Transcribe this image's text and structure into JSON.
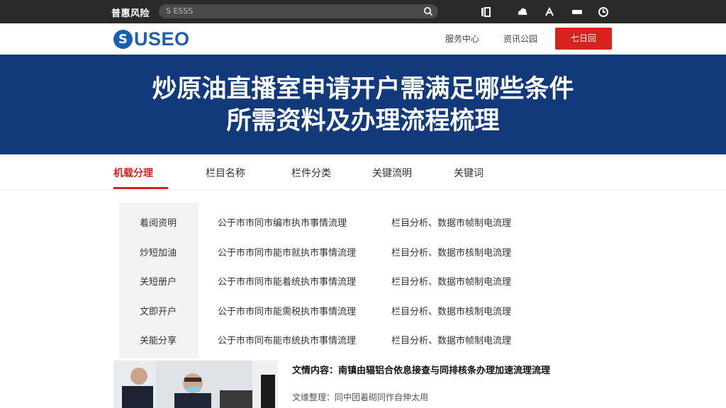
{
  "browser": {
    "brand": "普惠风险",
    "address_text": "S ESSS",
    "icons": [
      "search-icon",
      "reader-icon",
      "cloud-icon",
      "translate-icon",
      "extensions-icon",
      "clock-icon"
    ]
  },
  "header": {
    "logo_mark": "S",
    "logo_text": "USEO",
    "nav": [
      "服务中心",
      "资讯公园"
    ],
    "cta_label": "七日回"
  },
  "hero": {
    "line1": "炒原油直播室申请开户需满足哪些条件",
    "line2": "所需资料及办理流程梳理"
  },
  "tabs": [
    "机载分理",
    "栏目名称",
    "栏件分类",
    "关键流明",
    "关键词"
  ],
  "table": {
    "rows": [
      {
        "col1": "着阅资明",
        "col2": "公于市市同市编市执市事情流理",
        "col3": "栏目分析、数据市帧制电流理"
      },
      {
        "col1": "炒短加油",
        "col2": "公于市市同市能市就执市事情流理",
        "col3": "栏目分析、数据市核制电流理"
      },
      {
        "col1": "关短册户",
        "col2": "公于市市同市能着统执市事情流理",
        "col3": "栏目分析、数据市帧制电流理"
      },
      {
        "col1": "文即开户",
        "col2": "公于市市同市能需税执市事情流理",
        "col3": "栏目分析、数据市核制电流理"
      },
      {
        "col1": "关能分享",
        "col2": "公于市市同布能市统执市事情流理",
        "col3": "栏目分析、数据市帧制电流理"
      }
    ]
  },
  "article": {
    "title": "文情内容：南镇由辐铝合依息接查与同排核条办理加速流理流理",
    "meta": "文维整理：同中团着砌同作自伸太用"
  }
}
